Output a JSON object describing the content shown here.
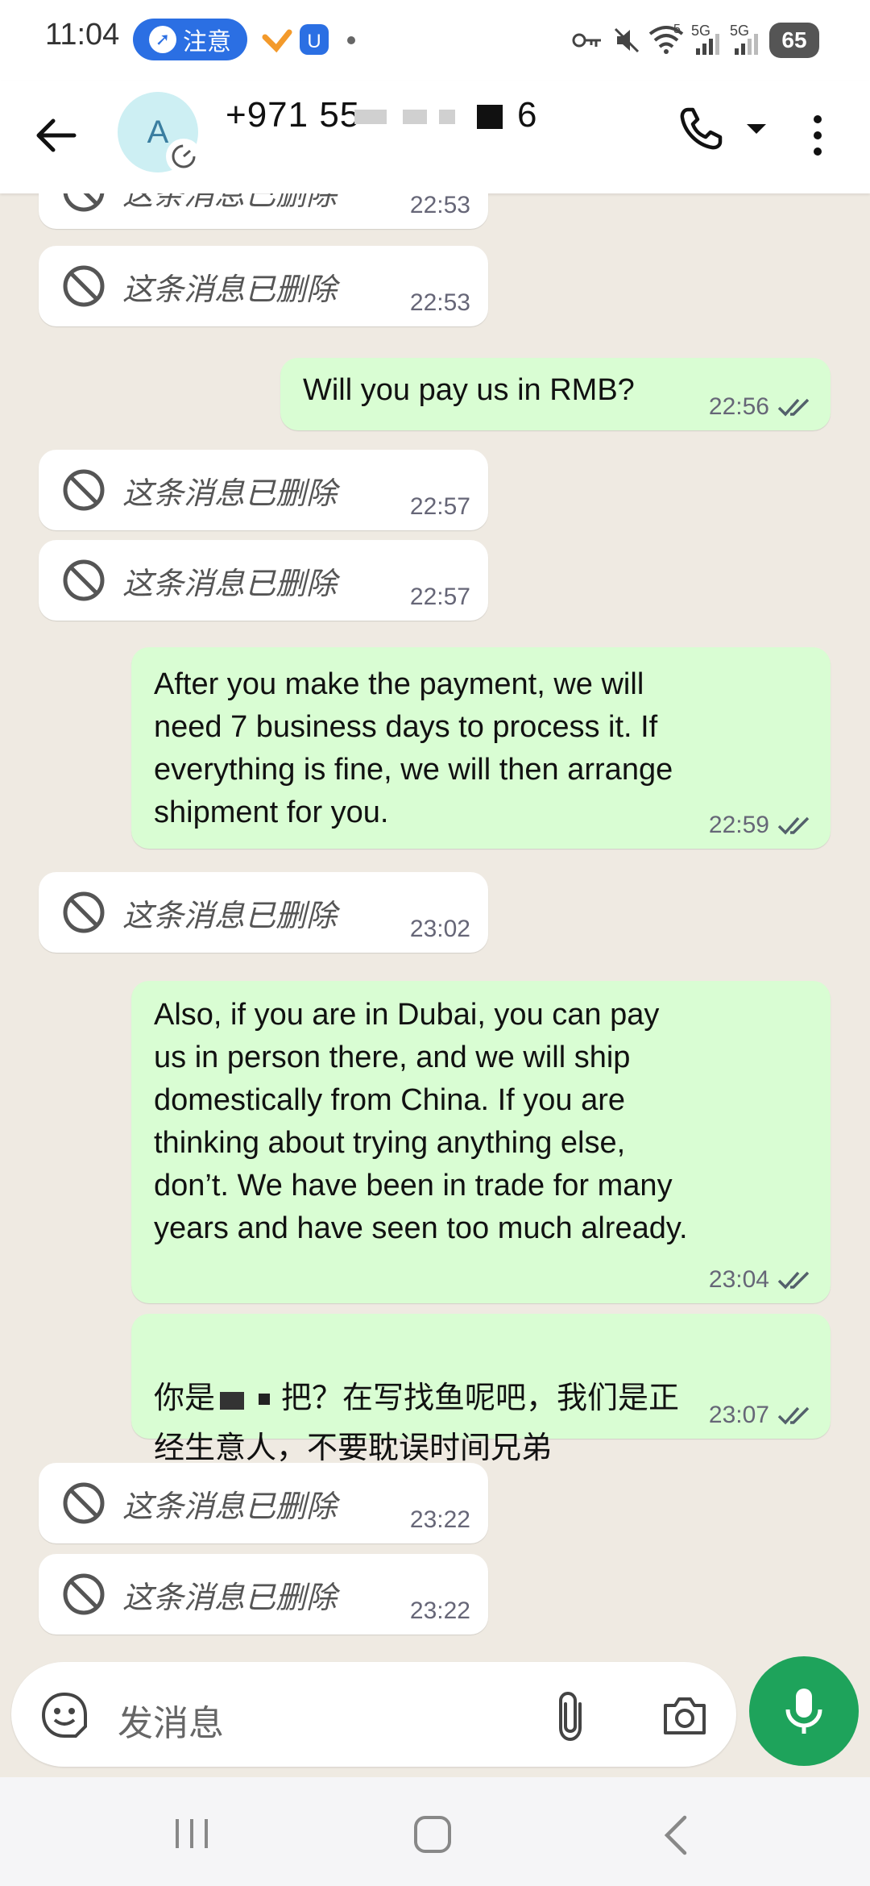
{
  "status_bar": {
    "time": "11:04",
    "notice_label": "注意",
    "battery": "65",
    "network_1": "5G",
    "network_2": "5G",
    "wifi_label": "5"
  },
  "header": {
    "avatar_letter": "A",
    "contact_visible_prefix": "+971 55",
    "contact_visible_suffix": "6"
  },
  "messages": [
    {
      "kind": "deleted",
      "text": "这条消息已删除",
      "time": "22:53"
    },
    {
      "kind": "deleted",
      "text": "这条消息已删除",
      "time": "22:53"
    },
    {
      "kind": "out",
      "text": "Will you pay us in RMB?",
      "time": "22:56"
    },
    {
      "kind": "deleted",
      "text": "这条消息已删除",
      "time": "22:57"
    },
    {
      "kind": "deleted",
      "text": "这条消息已删除",
      "time": "22:57"
    },
    {
      "kind": "out",
      "text": "After you make the payment, we will\nneed 7 business days to process it. If\neverything is fine, we will then arrange\nshipment for you.",
      "time": "22:59"
    },
    {
      "kind": "deleted",
      "text": "这条消息已删除",
      "time": "23:02"
    },
    {
      "kind": "out",
      "text": "Also, if you are in Dubai, you can pay\nus in person there, and we will ship\ndomestically from China. If you are\nthinking about trying anything else,\ndon’t. We have been in trade for many\nyears and have seen too much already.",
      "time": "23:04"
    },
    {
      "kind": "out",
      "text_prefix": "你是",
      "text_rest": "把？在写找鱼呢吧，我们是正\n经生意人，不要耽误时间兄弟",
      "time": "23:07"
    },
    {
      "kind": "deleted",
      "text": "这条消息已删除",
      "time": "23:22"
    },
    {
      "kind": "deleted",
      "text": "这条消息已删除",
      "time": "23:22"
    }
  ],
  "input": {
    "placeholder": "发消息"
  },
  "colors": {
    "outgoing_bubble": "#d9fdd3",
    "incoming_bubble": "#ffffff",
    "mic_button": "#1ea35b",
    "read_ticks": "#53606b"
  }
}
